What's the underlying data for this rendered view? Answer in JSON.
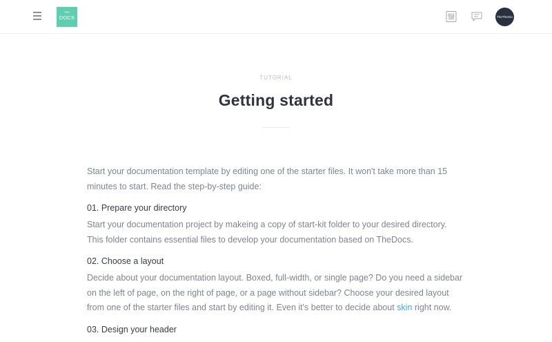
{
  "header": {
    "logo_small": "THE",
    "logo_big": "DOCS",
    "avatar_text": "TheThemio",
    "accent_color": "#5fcdb0",
    "icons": [
      "menu-icon",
      "settings-icon",
      "chat-icon"
    ]
  },
  "page": {
    "eyebrow": "TUTORIAL",
    "title": "Getting started"
  },
  "content": {
    "intro": "Start your documentation template by editing one of the starter files. It won't take more than 15 minutes to start. Read the step-by-step guide:",
    "sections": [
      {
        "heading": "01. Prepare your directory",
        "body": "Start your documentation project by makeing a copy of start-kit folder to your desired directory. This folder contains essential files to develop your documentation based on TheDocs."
      },
      {
        "heading": "02. Choose a layout",
        "body_before_link": "Decide about your documentation layout. Boxed, full-width, or single page? Do you need a sidebar on the left of page, on the right of page, or a page without sidebar? Choose your desired layout from one of the starter files and start by editing it. Even it's better to decide about ",
        "link": "skin",
        "body_after_link": " right now."
      },
      {
        "heading": "03. Design your header"
      }
    ]
  }
}
